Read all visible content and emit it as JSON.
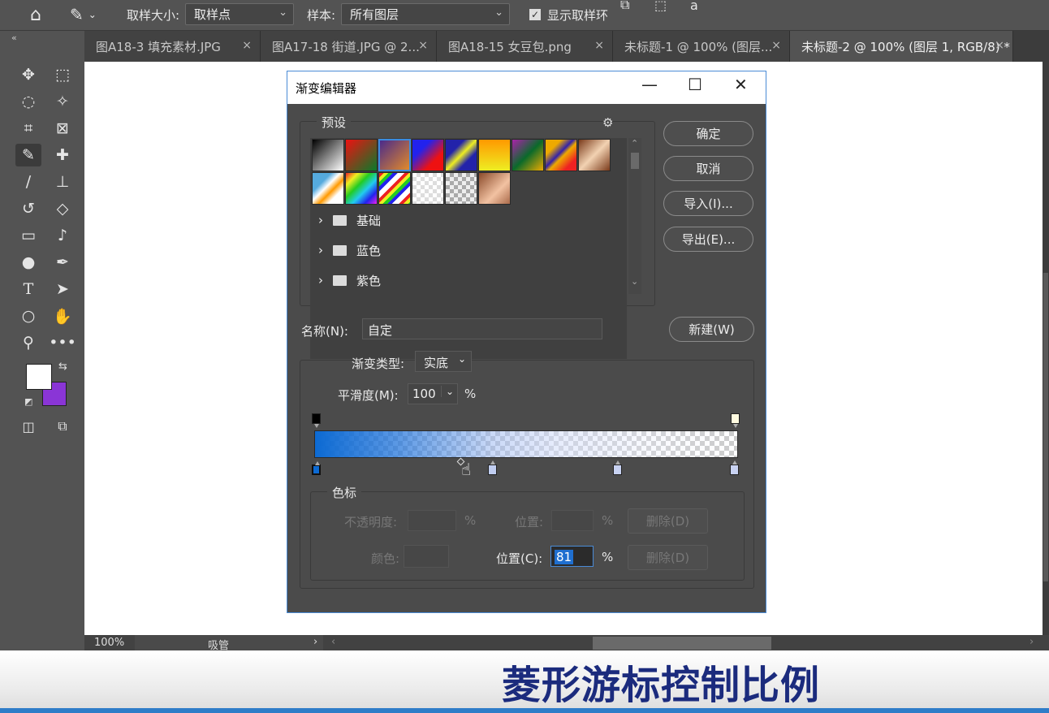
{
  "optbar": {
    "sample_size_label": "取样大小:",
    "sample_size_value": "取样点",
    "sample_label": "样本:",
    "sample_value": "所有图层",
    "show_ring_label": "显示取样环"
  },
  "tabs": [
    {
      "label": "图A18-3 填充素材.JPG"
    },
    {
      "label": "图A17-18 街道.JPG @ 2..."
    },
    {
      "label": "图A18-15 女豆包.png"
    },
    {
      "label": "未标题-1 @ 100% (图层..."
    },
    {
      "label": "未标题-2 @ 100% (图层 1, RGB/8) *"
    }
  ],
  "tab_close": "×",
  "status": {
    "zoom": "100%",
    "tool": "吸管"
  },
  "caption": "菱形游标控制比例",
  "dialog": {
    "title": "渐变编辑器",
    "presets_label": "预设",
    "folders": [
      "基础",
      "蓝色",
      "紫色"
    ],
    "buttons": {
      "ok": "确定",
      "cancel": "取消",
      "import": "导入(I)...",
      "export": "导出(E)...",
      "new": "新建(W)"
    },
    "name_label": "名称(N):",
    "name_value": "自定",
    "type_label": "渐变类型:",
    "type_value": "实底",
    "smooth_label": "平滑度(M):",
    "smooth_value": "100",
    "percent": "%",
    "stops_label": "色标",
    "opacity_label": "不透明度:",
    "location_label": "位置:",
    "delete_label": "删除(D)",
    "color_label": "颜色:",
    "location_c_label": "位置(C):",
    "location_c_value": "81"
  }
}
